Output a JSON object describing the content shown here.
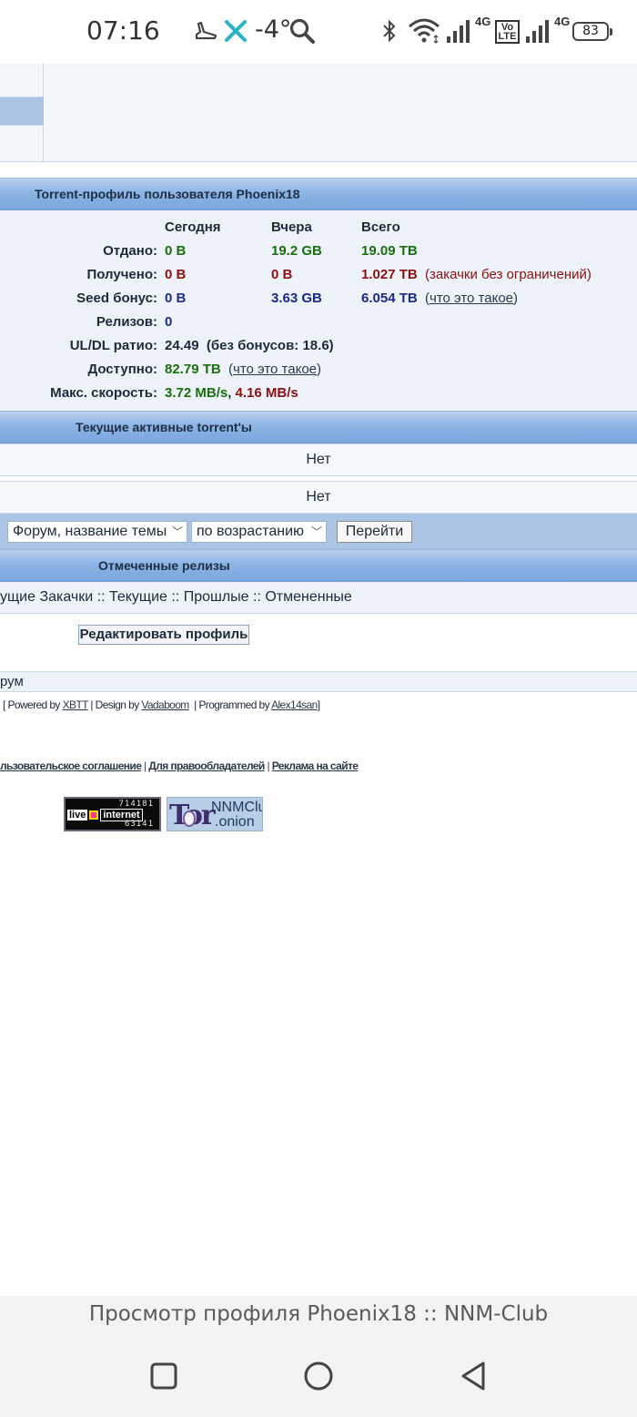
{
  "status_bar": {
    "time": "07:16",
    "temperature": "-4°",
    "network_label_1": "4G",
    "network_label_2": "4G",
    "volte_label": "Vo LTE",
    "battery": "83",
    "icons": [
      "sneaker-icon",
      "x-app-icon",
      "search-icon",
      "bluetooth-icon",
      "wifi-icon",
      "signal-icon",
      "volte-icon",
      "signal-icon",
      "battery-icon"
    ]
  },
  "profile": {
    "title": "Torrent-профиль пользователя Phoenix18",
    "columns": [
      "Сегодня",
      "Вчера",
      "Всего"
    ],
    "rows": {
      "given": {
        "label": "Отдано:",
        "today": "0 B",
        "yesterday": "19.2 GB",
        "total": "19.09 TB"
      },
      "received": {
        "label": "Получено:",
        "today": "0 B",
        "yesterday": "0 B",
        "total": "1.027 TB",
        "note": "(закачки без ограничений)"
      },
      "seed_bonus": {
        "label": "Seed бонус:",
        "today": "0 B",
        "yesterday": "3.63 GB",
        "total": "6.054 TB",
        "note_open": "(",
        "note_link": "что это такое",
        "note_close": ")"
      },
      "releases": {
        "label": "Релизов:",
        "value": "0"
      },
      "ratio": {
        "label": "UL/DL ратио:",
        "value": "24.49",
        "note": "(без бонусов: 18.6)"
      },
      "available": {
        "label": "Доступно:",
        "value": "82.79 TB",
        "note_open": "(",
        "note_link": "что это такое",
        "note_close": ")"
      },
      "max_speed": {
        "label": "Макс. скорость:",
        "upload": "3.72 MB/s",
        "separator": ",",
        "download": "4.16 MB/s"
      }
    }
  },
  "active_torrents": {
    "title": "Текущие активные torrent'ы",
    "row1": "Нет",
    "row2": "Нет"
  },
  "sort_bar": {
    "sort_field": "Форум, название темы",
    "sort_order": "по возрастанию",
    "go_button": "Перейти"
  },
  "marked_releases": {
    "title": "Отмеченные релизы",
    "links_text": "ущие Закачки :: Текущие :: Прошлые :: Отмененные"
  },
  "edit_profile_button": "Редактировать профиль",
  "forum_label": "рум",
  "credits": {
    "open": "[ Powered by",
    "xbtt": "XBTT",
    "design": "| Design by",
    "vadaboom": "Vadaboom",
    "programmed": "| Programmed by",
    "alex": "Alex14san",
    "close": "]"
  },
  "footer_links": {
    "agreement": "льзовательское соглашение",
    "sep": "|",
    "rights": "Для правообладателей",
    "ads": "Реклама на сайте"
  },
  "badges": {
    "liveinternet_top": "714181",
    "liveinternet_bottom": "63141",
    "liveinternet_live": "live",
    "liveinternet_internet": "internet",
    "tor_logo": "Tor",
    "tor_line1": "NNMClub",
    "tor_line2": ".onion"
  },
  "browser": {
    "page_title": "Просмотр профиля Phoenix18 :: NNM-Club"
  },
  "colors": {
    "header_blue": "#7aa6de",
    "green_value": "#1a6d0f",
    "red_value": "#8c1010",
    "blue_value": "#1b2a8c"
  }
}
